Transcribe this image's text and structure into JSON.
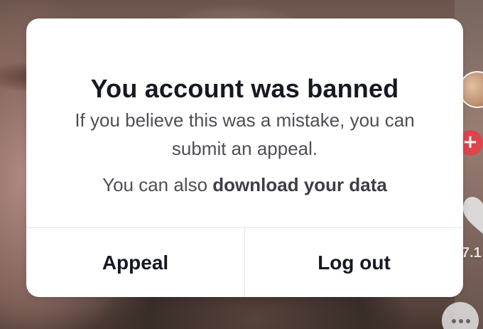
{
  "dialog": {
    "title": "You account was banned",
    "message": "If you believe this was a mistake, you can submit an appeal.",
    "secondary_prefix": "You can also ",
    "secondary_link": "download your data",
    "appeal_label": "Appeal",
    "logout_label": "Log out"
  },
  "background": {
    "like_count": "7.1",
    "follow_icon": "plus-icon",
    "like_icon": "heart-icon",
    "comment_icon": "comment-icon"
  },
  "colors": {
    "follow_button": "#e8474f",
    "title_text": "#161823",
    "body_text": "#4d4f56"
  }
}
